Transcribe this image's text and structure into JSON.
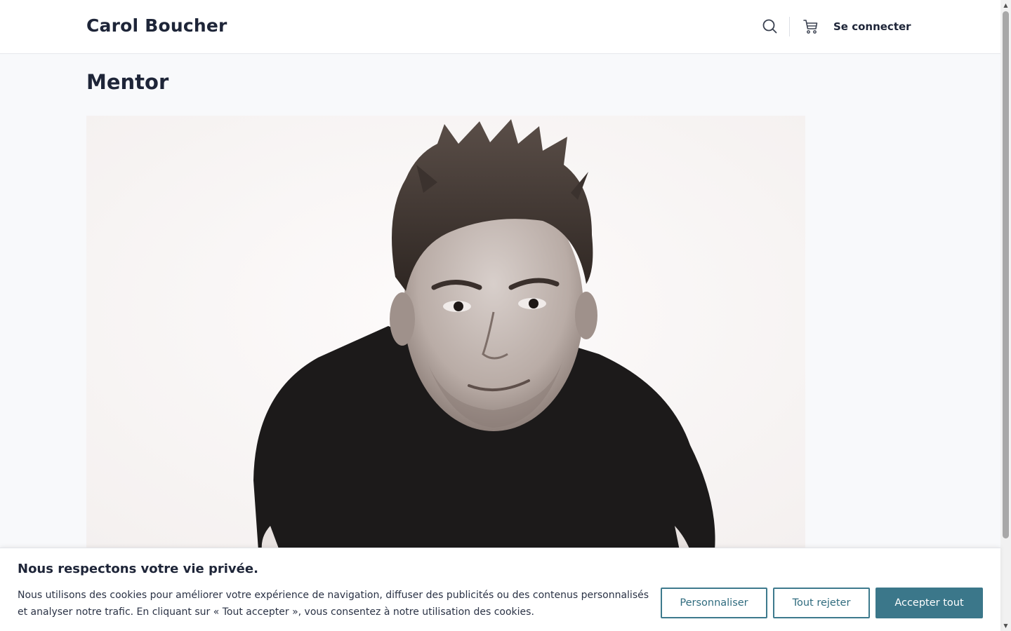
{
  "header": {
    "brand": "Carol Boucher",
    "search_icon": "search-icon",
    "cart_icon": "cart-icon",
    "login_label": "Se connecter"
  },
  "main": {
    "title": "Mentor",
    "image": "portrait-photo"
  },
  "cookie_banner": {
    "title": "Nous respectons votre vie privée.",
    "text": "Nous utilisons des cookies pour améliorer votre expérience de navigation, diffuser des publicités ou des contenus personnalisés et analyser notre trafic. En cliquant sur « Tout accepter », vous consentez à notre utilisation des cookies.",
    "customize_label": "Personnaliser",
    "reject_label": "Tout rejeter",
    "accept_label": "Accepter tout"
  },
  "colors": {
    "accent": "#3b778a",
    "text": "#1e2538",
    "background": "#f8f9fb"
  }
}
